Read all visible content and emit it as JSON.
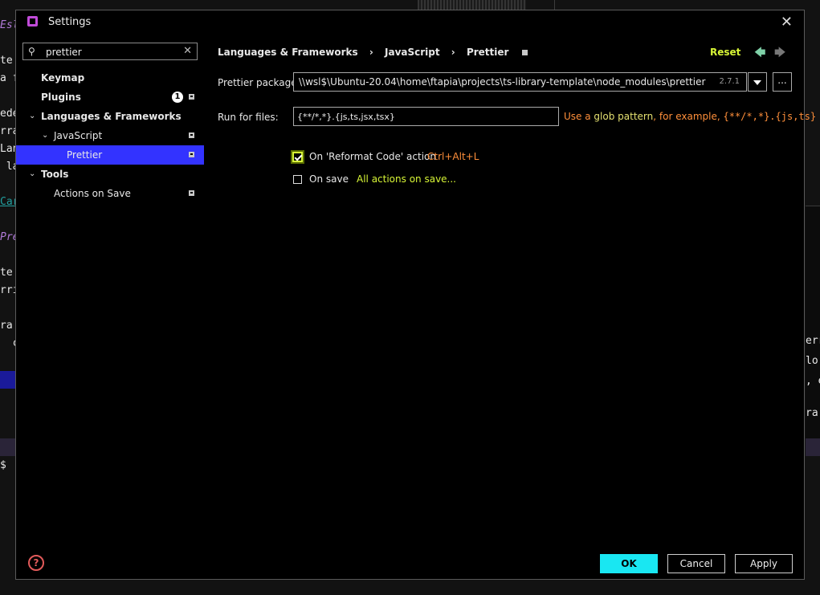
{
  "window": {
    "title": "Settings"
  },
  "search": {
    "value": "prettier"
  },
  "sidebar": {
    "items": [
      {
        "label": "Keymap"
      },
      {
        "label": "Plugins",
        "badge": "1"
      },
      {
        "label": "Languages & Frameworks"
      },
      {
        "label": "JavaScript"
      },
      {
        "label": "Prettier"
      },
      {
        "label": "Tools"
      },
      {
        "label": "Actions on Save"
      }
    ]
  },
  "breadcrumb": {
    "items": [
      "Languages & Frameworks",
      "JavaScript",
      "Prettier"
    ],
    "separator": "›"
  },
  "header": {
    "reset_label": "Reset"
  },
  "prettier_package": {
    "label": "Prettier package:",
    "value": "\\\\wsl$\\Ubuntu-20.04\\home\\ftapia\\projects\\ts-library-template\\node_modules\\prettier",
    "version": "2.7.1",
    "browse_label": "..."
  },
  "run_for_files": {
    "label": "Run for files:",
    "value": "{**/*,*}.{js,ts,jsx,tsx}",
    "hint_prefix": "Use a",
    "hint_glob": "glob pattern",
    "hint_mid": ", for example,",
    "hint_example": "{**/*,*}.{js,ts}"
  },
  "options": {
    "reformat_label": "On 'Reformat Code' action",
    "reformat_shortcut": "Ctrl+Alt+L",
    "reformat_checked": true,
    "save_label": "On save",
    "save_link": "All actions on save...",
    "save_checked": false
  },
  "footer": {
    "help_label": "?",
    "ok_label": "OK",
    "cancel_label": "Cancel",
    "apply_label": "Apply"
  },
  "background": {
    "left_fragments": [
      "Esl",
      "te",
      "a f",
      "ede",
      "rra",
      "Lan",
      " la",
      "Car",
      "Pre",
      "te",
      "rri",
      "ra",
      "  c",
      "$"
    ],
    "right_fragments": [
      "err",
      "lo c",
      ", et",
      "ra"
    ]
  },
  "colors": {
    "accent_ok": "#19e7f2",
    "accent_green": "#d7f536",
    "hint_orange": "#ff8f3a",
    "selection": "#3333ff"
  }
}
